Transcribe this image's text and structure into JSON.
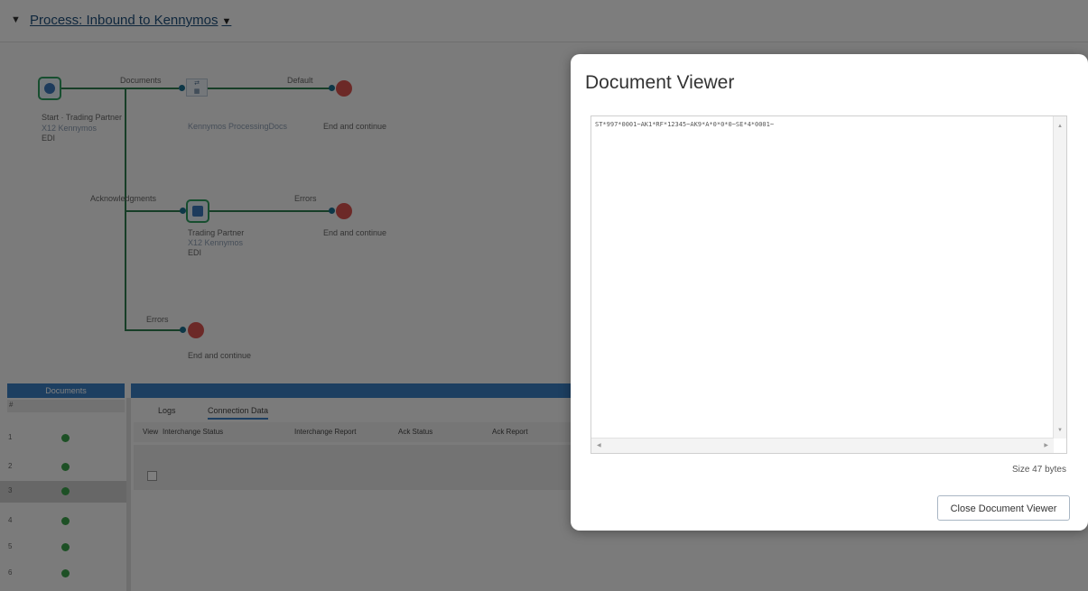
{
  "process_title": "Process: Inbound to Kennymos",
  "process_caret": "▼",
  "collapse_marker": "▼",
  "canvas": {
    "labels": {
      "documents": "Documents",
      "default": "Default",
      "ack_assignments": "Acknowledgments",
      "errors_top": "Errors",
      "errors_bottom": "Errors",
      "start_title": "Start · Trading Partner",
      "start_sub1": "X12 Kennymos",
      "start_sub2": "EDI",
      "map_label": "Kennymos ProcessingDocs",
      "end1": "End and continue",
      "tp_title": "Trading Partner",
      "tp_sub1": "X12 Kennymos",
      "tp_sub2": "EDI",
      "end2": "End and continue",
      "end3": "End and continue"
    }
  },
  "bottom": {
    "documents_header": "Documents",
    "col_marker": "#",
    "rows": [
      "1",
      "2",
      "3",
      "4",
      "5",
      "6"
    ],
    "selected_row": 2,
    "tabs": [
      "Logs",
      "Connection Data"
    ],
    "active_tab": "Connection Data",
    "toolbar": [
      "View",
      "Interchange Status",
      "Interchange Report",
      "Ack Status",
      "Ack Report"
    ]
  },
  "modal": {
    "title": "Document Viewer",
    "content": "ST*997*0001~AK1*RF*12345~AK9*A*0*0*0~SE*4*0001~",
    "size_text": "Size 47 bytes",
    "close_label": "Close Document Viewer"
  }
}
